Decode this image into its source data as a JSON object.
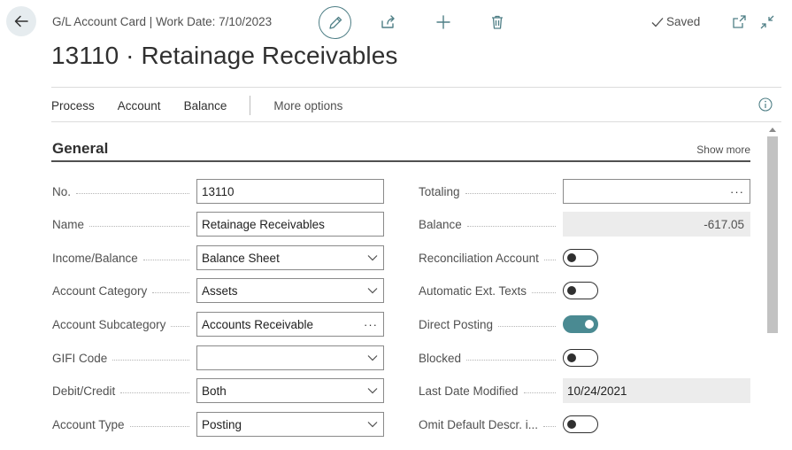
{
  "header": {
    "context": "G/L Account Card | Work Date: 7/10/2023",
    "title": "13110 · Retainage Receivables",
    "saved": "Saved"
  },
  "actions": {
    "process": "Process",
    "account": "Account",
    "balance": "Balance",
    "more": "More options"
  },
  "section": {
    "title": "General",
    "show_more": "Show more"
  },
  "left_fields": {
    "no": {
      "label": "No.",
      "value": "13110"
    },
    "name": {
      "label": "Name",
      "value": "Retainage Receivables"
    },
    "income_balance": {
      "label": "Income/Balance",
      "value": "Balance Sheet"
    },
    "account_category": {
      "label": "Account Category",
      "value": "Assets"
    },
    "account_subcategory": {
      "label": "Account Subcategory",
      "value": "Accounts Receivable"
    },
    "gifi_code": {
      "label": "GIFI Code",
      "value": ""
    },
    "debit_credit": {
      "label": "Debit/Credit",
      "value": "Both"
    },
    "account_type": {
      "label": "Account Type",
      "value": "Posting"
    }
  },
  "right_fields": {
    "totaling": {
      "label": "Totaling",
      "value": ""
    },
    "balance": {
      "label": "Balance",
      "value": "-617.05"
    },
    "reconciliation_account": {
      "label": "Reconciliation Account",
      "on": false
    },
    "automatic_ext_texts": {
      "label": "Automatic Ext. Texts",
      "on": false
    },
    "direct_posting": {
      "label": "Direct Posting",
      "on": true
    },
    "blocked": {
      "label": "Blocked",
      "on": false
    },
    "last_date_modified": {
      "label": "Last Date Modified",
      "value": "10/24/2021"
    },
    "omit_default_descr": {
      "label": "Omit Default Descr. i...",
      "on": false
    }
  },
  "misc": {
    "ellipsis": "···"
  },
  "icons": {
    "back": "arrow-left-icon",
    "edit": "pencil-icon",
    "share": "share-icon",
    "new": "plus-icon",
    "delete": "trash-icon",
    "saved": "checkmark-icon",
    "open_new_window": "open-in-new-window-icon",
    "collapse": "collapse-icon",
    "info": "info-icon"
  },
  "colors": {
    "accent": "#4a8a92",
    "edit_ring": "#4f7f86",
    "readonly_bg": "#ececec"
  }
}
